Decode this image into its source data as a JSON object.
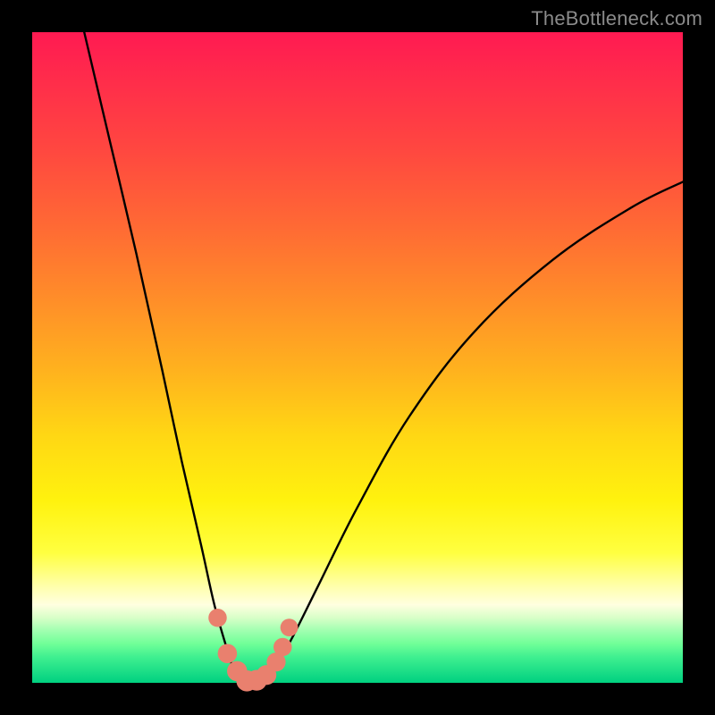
{
  "watermark": {
    "text": "TheBottleneck.com"
  },
  "colors": {
    "curve_stroke": "#000000",
    "marker_fill": "#e9806e",
    "marker_stroke": "#c45a48",
    "background_black": "#000000"
  },
  "chart_data": {
    "type": "line",
    "title": "",
    "xlabel": "",
    "ylabel": "",
    "xlim": [
      0,
      100
    ],
    "ylim": [
      0,
      100
    ],
    "note": "V-shaped bottleneck curve. y represents bottleneck severity (0 = none/green, 100 = severe/red). Minimum (optimal match) occurs near x ≈ 33.",
    "series": [
      {
        "name": "bottleneck-curve",
        "x": [
          8,
          12,
          16,
          20,
          23,
          26,
          28,
          30,
          31,
          32,
          33,
          34,
          35,
          36,
          38,
          40,
          44,
          50,
          58,
          68,
          80,
          92,
          100
        ],
        "y": [
          100,
          83,
          66,
          48,
          34,
          21,
          12,
          5,
          2,
          0.5,
          0,
          0.2,
          0.6,
          1.2,
          3.5,
          7,
          15,
          27,
          41,
          54,
          65,
          73,
          77
        ]
      }
    ],
    "markers": {
      "name": "highlight-points",
      "x": [
        28.5,
        30.0,
        31.5,
        33.0,
        34.5,
        36.0,
        37.5,
        38.5,
        39.5
      ],
      "y": [
        10.0,
        4.5,
        1.8,
        0.3,
        0.4,
        1.2,
        3.2,
        5.5,
        8.5
      ]
    }
  }
}
